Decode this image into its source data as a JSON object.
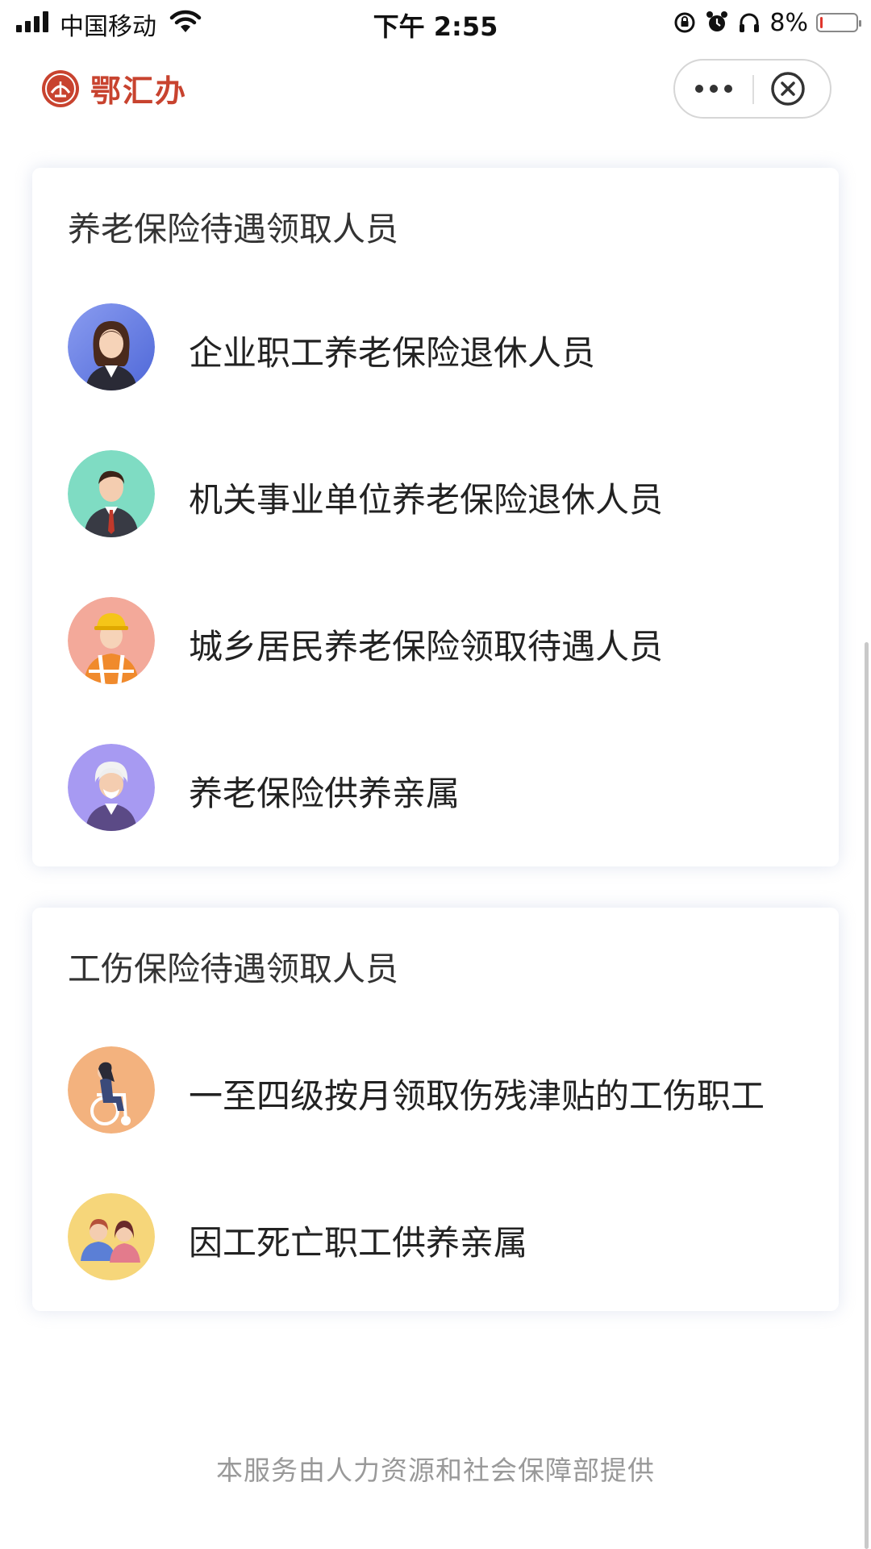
{
  "status_bar": {
    "carrier": "中国移动",
    "time": "下午 2:55",
    "battery_percent": "8%",
    "battery_level": 0.08,
    "icons": [
      "signal-icon",
      "wifi-icon",
      "rotation-lock-icon",
      "alarm-icon",
      "headphones-icon",
      "battery-icon"
    ]
  },
  "header": {
    "brand_name": "鄂汇办",
    "menu_icon": "more-dots-icon",
    "close_icon": "close-circle-icon",
    "brand_color": "#c8432f"
  },
  "sections": [
    {
      "title": "养老保险待遇领取人员",
      "items": [
        {
          "label": "企业职工养老保险退休人员",
          "icon": "female-employee-avatar-icon"
        },
        {
          "label": "机关事业单位养老保险退休人员",
          "icon": "male-official-avatar-icon"
        },
        {
          "label": "城乡居民养老保险领取待遇人员",
          "icon": "worker-avatar-icon"
        },
        {
          "label": "养老保险供养亲属",
          "icon": "elderly-avatar-icon"
        }
      ]
    },
    {
      "title": "工伤保险待遇领取人员",
      "items": [
        {
          "label": "一至四级按月领取伤残津贴的工伤职工",
          "icon": "wheelchair-avatar-icon"
        },
        {
          "label": "因工死亡职工供养亲属",
          "icon": "family-avatar-icon"
        }
      ]
    }
  ],
  "footer": "本服务由人力资源和社会保障部提供"
}
